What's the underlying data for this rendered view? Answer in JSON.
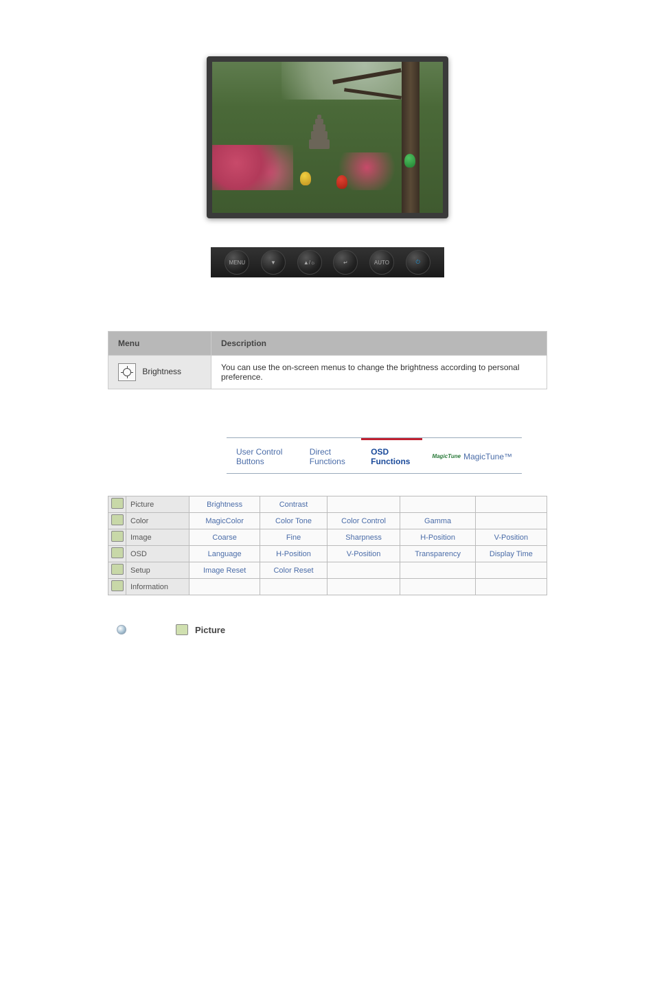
{
  "monitor_image_alt": "Landscape photo with trees, pagoda and lanterns shown on monitor screen",
  "hw_buttons": [
    "MENU",
    "▼",
    "▲/☼",
    "↵",
    "AUTO",
    "⏻"
  ],
  "desc_table": {
    "col_menu": "Menu",
    "col_desc": "Description",
    "row_menu_label": "Brightness",
    "row_desc": "You can use the on-screen menus to change the brightness according to personal preference."
  },
  "tabs": {
    "t1": "User Control Buttons",
    "t2": "Direct Functions",
    "t3": "OSD Functions",
    "t4": "MagicTune™",
    "mt_logo": "MagicTune"
  },
  "osd": {
    "rows": [
      {
        "cat": "Picture",
        "items": [
          "Brightness",
          "Contrast",
          "",
          "",
          ""
        ]
      },
      {
        "cat": "Color",
        "items": [
          "MagicColor",
          "Color Tone",
          "Color Control",
          "Gamma",
          ""
        ]
      },
      {
        "cat": "Image",
        "items": [
          "Coarse",
          "Fine",
          "Sharpness",
          "H-Position",
          "V-Position"
        ]
      },
      {
        "cat": "OSD",
        "items": [
          "Language",
          "H-Position",
          "V-Position",
          "Transparency",
          "Display Time"
        ]
      },
      {
        "cat": "Setup",
        "items": [
          "Image Reset",
          "Color Reset",
          "",
          "",
          ""
        ]
      },
      {
        "cat": "Information",
        "items": [
          "",
          "",
          "",
          "",
          ""
        ]
      }
    ]
  },
  "section_picture": "Picture"
}
